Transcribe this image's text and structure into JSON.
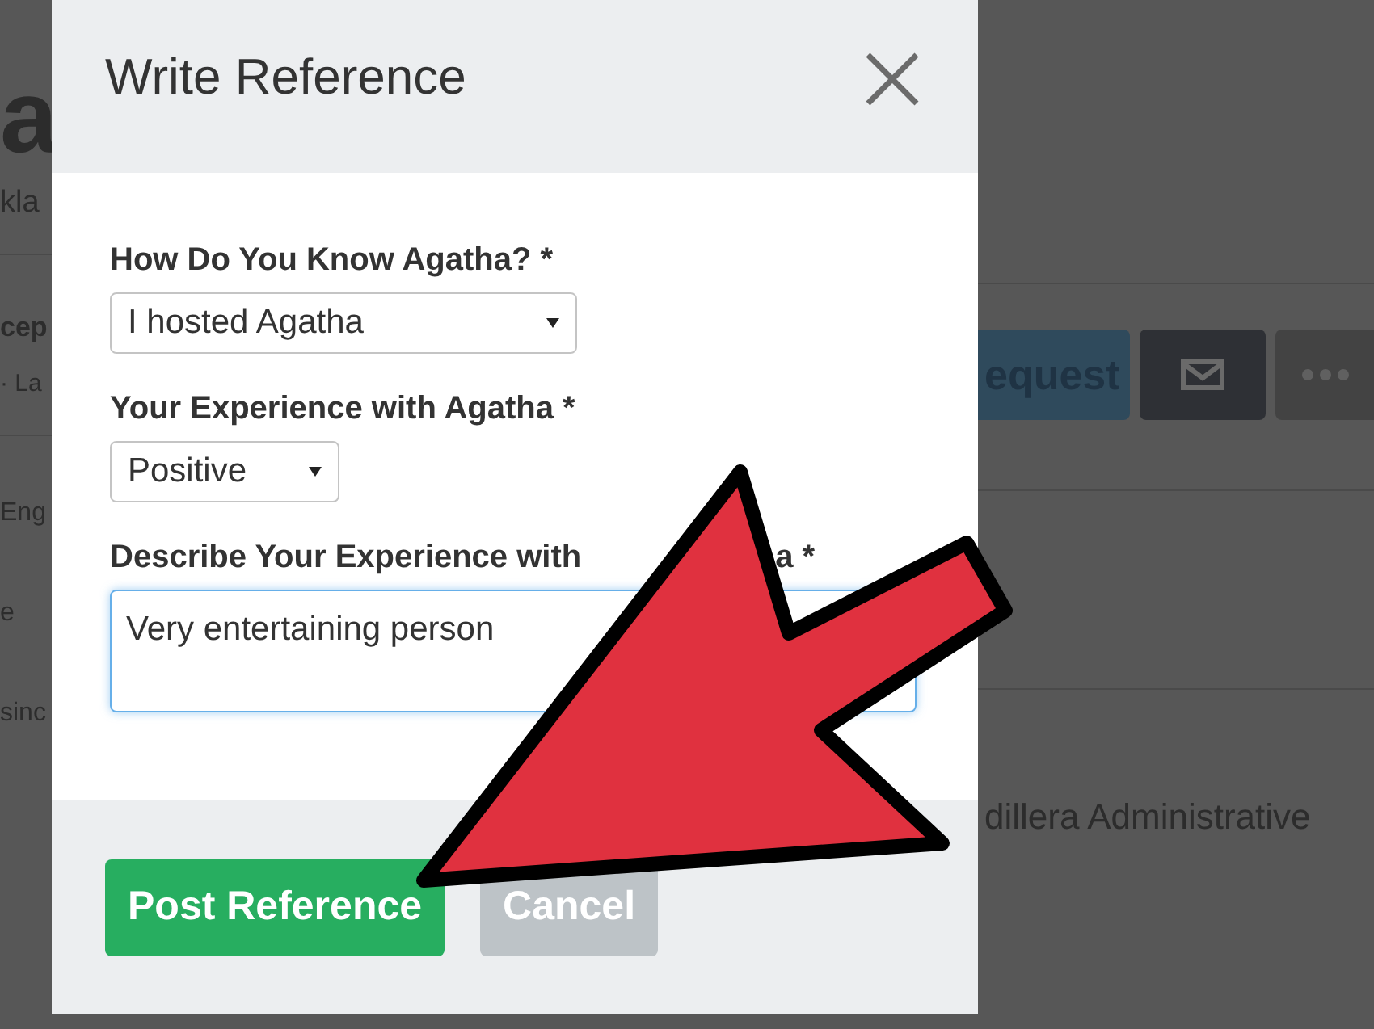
{
  "background": {
    "left_texts": [
      {
        "text": "a",
        "kind": "title"
      },
      {
        "text": "kla",
        "kind": "subtitle"
      },
      {
        "text": "cep",
        "kind": "heading"
      },
      {
        "text": "· La",
        "kind": "meta"
      },
      {
        "text": "Eng",
        "kind": "body"
      },
      {
        "text": "e",
        "kind": "body"
      },
      {
        "text": "sinc",
        "kind": "body"
      }
    ],
    "buttons": [
      {
        "kind": "primary",
        "label": "equest"
      },
      {
        "kind": "mail"
      },
      {
        "kind": "more"
      }
    ],
    "right_text": "dillera Administrative"
  },
  "modal": {
    "title": "Write Reference",
    "fields": [
      {
        "kind": "select",
        "label": [
          "How Do You Know Agatha? *"
        ],
        "value": "I hosted Agatha"
      },
      {
        "kind": "select",
        "label": [
          "Your Experience with Agatha *"
        ],
        "value": "Positive"
      },
      {
        "kind": "textarea",
        "label": [
          "Describe Your Experience with",
          "a *"
        ],
        "value": "Very entertaining person"
      }
    ],
    "buttons": [
      {
        "kind": "primary",
        "label": "Post Reference"
      },
      {
        "kind": "secondary",
        "label": "Cancel"
      }
    ]
  }
}
